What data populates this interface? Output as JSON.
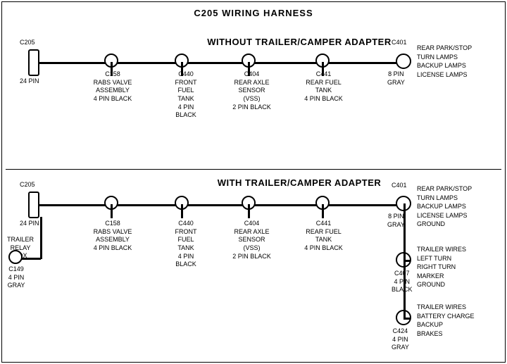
{
  "title": "C205 WIRING HARNESS",
  "section1": {
    "label": "WITHOUT TRAILER/CAMPER ADAPTER",
    "connectors": [
      {
        "id": "C205_1",
        "label": "C205\n24 PIN"
      },
      {
        "id": "C401_1",
        "label": "C401\n8 PIN\nGRAY"
      },
      {
        "id": "C158_1",
        "label": "C158\nRABS VALVE\nASSEMBLY\n4 PIN BLACK"
      },
      {
        "id": "C440_1",
        "label": "C440\nFRONT FUEL\nTANK\n4 PIN BLACK"
      },
      {
        "id": "C404_1",
        "label": "C404\nREAR AXLE\nSENSOR\n(VSS)\n2 PIN BLACK"
      },
      {
        "id": "C441_1",
        "label": "C441\nREAR FUEL\nTANK\n4 PIN BLACK"
      }
    ],
    "right_label": "REAR PARK/STOP\nTURN LAMPS\nBACKUP LAMPS\nLICENSE LAMPS"
  },
  "section2": {
    "label": "WITH TRAILER/CAMPER ADAPTER",
    "connectors": [
      {
        "id": "C205_2",
        "label": "C205\n24 PIN"
      },
      {
        "id": "C401_2",
        "label": "C401\n8 PIN\nGRAY"
      },
      {
        "id": "C158_2",
        "label": "C158\nRABS VALVE\nASSEMBLY\n4 PIN BLACK"
      },
      {
        "id": "C440_2",
        "label": "C440\nFRONT FUEL\nTANK\n4 PIN BLACK"
      },
      {
        "id": "C404_2",
        "label": "C404\nREAR AXLE\nSENSOR\n(VSS)\n2 PIN BLACK"
      },
      {
        "id": "C441_2",
        "label": "C441\nREAR FUEL\nTANK\n4 PIN BLACK"
      },
      {
        "id": "C149",
        "label": "C149\n4 PIN GRAY"
      },
      {
        "id": "C407",
        "label": "C407\n4 PIN\nBLACK"
      },
      {
        "id": "C424",
        "label": "C424\n4 PIN\nGRAY"
      }
    ],
    "right_labels": [
      "REAR PARK/STOP\nTURN LAMPS\nBACKUP LAMPS\nLICENSE LAMPS\nGROUND",
      "TRAILER WIRES\nLEFT TURN\nRIGHT TURN\nMARKER\nGROUND",
      "TRAILER WIRES\nBATTERY CHARGE\nBACKUP\nBRAKES"
    ],
    "trailer_relay": "TRAILER\nRELAY\nBOX"
  }
}
